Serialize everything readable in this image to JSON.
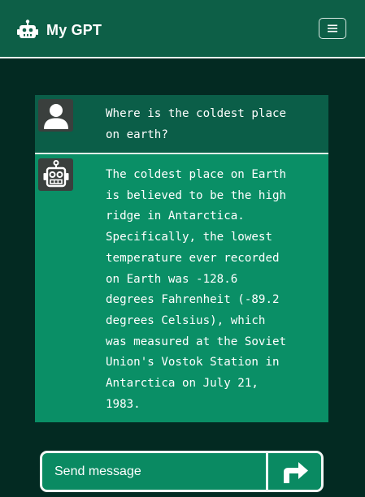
{
  "app": {
    "title": "My GPT",
    "logo_icon": "robot-icon",
    "menu_icon": "hamburger-menu-icon"
  },
  "colors": {
    "background": "#032a22",
    "navbar": "#0d5f47",
    "user_message_bg": "#0b5e48",
    "bot_message_bg": "#0a8f66",
    "text": "#ffffff"
  },
  "messages": [
    {
      "role": "user",
      "avatar_icon": "user-icon",
      "text": "Where is the coldest place\non earth?"
    },
    {
      "role": "assistant",
      "avatar_icon": "robot-icon",
      "text": "The coldest place on Earth\nis believed to be the high\nridge in Antarctica.\nSpecifically, the lowest\ntemperature ever recorded\non Earth was -128.6\ndegrees Fahrenheit (-89.2\ndegrees Celsius), which\nwas measured at the Soviet\nUnion's Vostok Station in\nAntarctica on July 21,\n1983."
    }
  ],
  "composer": {
    "placeholder": "Send message",
    "value": "",
    "send_icon": "arrow-turn-right-icon"
  }
}
